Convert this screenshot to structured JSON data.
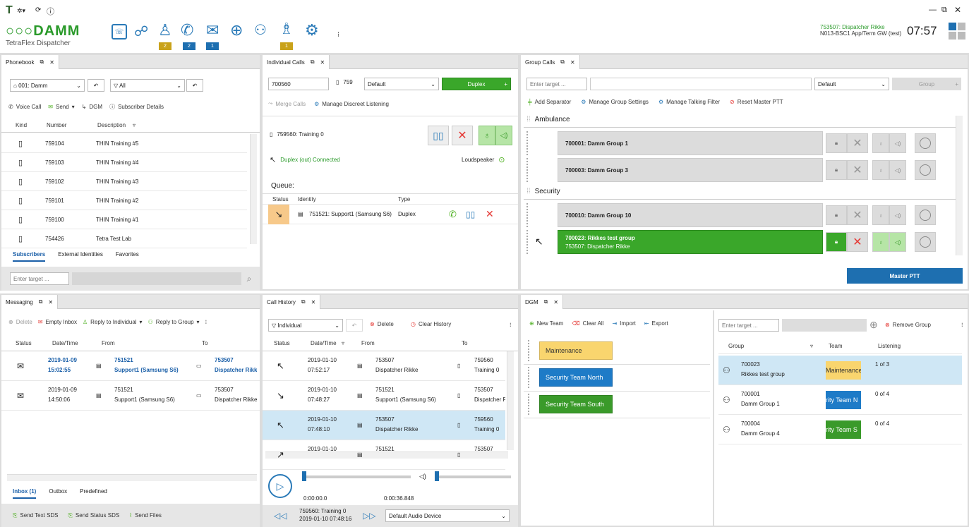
{
  "titlebar": {
    "controls": [
      "—",
      "⧉",
      "✕"
    ]
  },
  "brand": {
    "name": "DAMM",
    "product": "TetraFlex Dispatcher"
  },
  "badges": [
    {
      "count": "2",
      "color": "#c9a21a"
    },
    {
      "count": "2",
      "color": "#1e6fb0"
    },
    {
      "count": "1",
      "color": "#1e6fb0"
    },
    {
      "count": "1",
      "color": "#c9a21a"
    }
  ],
  "status": {
    "user": "753507: Dispatcher Rikke",
    "node": "N013-BSC1 App/Term GW (test)",
    "time": "07:57"
  },
  "phonebook": {
    "tab": "Phonebook",
    "org": "001: Damm",
    "filter": "All",
    "actions": {
      "voice": "Voice Call",
      "send": "Send",
      "dgm": "DGM",
      "details": "Subscriber Details"
    },
    "columns": [
      "Kind",
      "Number",
      "Description"
    ],
    "rows": [
      {
        "number": "759104",
        "desc": "THIN Training #5"
      },
      {
        "number": "759103",
        "desc": "THIN Training #4"
      },
      {
        "number": "759102",
        "desc": "THIN Training #3"
      },
      {
        "number": "759101",
        "desc": "THIN Training #2"
      },
      {
        "number": "759100",
        "desc": "THIN Training #1"
      },
      {
        "number": "754426",
        "desc": "Tetra Test Lab"
      }
    ],
    "subtabs": [
      "Subscribers",
      "External Identities",
      "Favorites"
    ],
    "target_placeholder": "Enter target ..."
  },
  "individual": {
    "tab": "Individual Calls",
    "target": "700560",
    "count": "759",
    "profile": "Default",
    "mode": "Duplex",
    "merge": "Merge Calls",
    "discreet": "Manage Discreet Listening",
    "call_name": "759560: Training 0",
    "call_status": "Duplex (out) Connected",
    "loudspeaker": "Loudspeaker",
    "queue_label": "Queue:",
    "queue_cols": [
      "Status",
      "Identity",
      "Type"
    ],
    "queue_row": {
      "identity": "751521: Support1 (Samsung S6)",
      "type": "Duplex"
    }
  },
  "group": {
    "tab": "Group Calls",
    "target_placeholder": "Enter target ...",
    "profile": "Default",
    "group_btn": "Group",
    "actions": {
      "sep": "Add Separator",
      "settings": "Manage Group Settings",
      "filter": "Manage Talking Filter",
      "reset": "Reset Master PTT"
    },
    "sections": [
      {
        "name": "Ambulance",
        "rows": [
          {
            "title": "700001:  Damm Group 1"
          },
          {
            "title": "700003:  Damm Group 3"
          }
        ]
      },
      {
        "name": "Security",
        "rows": [
          {
            "title": "700010:  Damm Group 10"
          },
          {
            "title": "700023:  Rikkes test group",
            "sub": "753507:  Dispatcher Rikke"
          }
        ]
      }
    ],
    "master": "Master PTT"
  },
  "messaging": {
    "tab": "Messaging",
    "actions": {
      "delete": "Delete",
      "empty": "Empty Inbox",
      "reply_ind": "Reply to Individual",
      "reply_grp": "Reply to Group"
    },
    "columns": [
      "Status",
      "Date/Time",
      "From",
      "To"
    ],
    "rows": [
      {
        "date": "2019-01-09",
        "time": "15:02:55",
        "from_id": "751521",
        "from": "Support1 (Samsung S6)",
        "to_id": "753507",
        "to": "Dispatcher Rikke"
      },
      {
        "date": "2019-01-09",
        "time": "14:50:06",
        "from_id": "751521",
        "from": "Support1 (Samsung S6)",
        "to_id": "753507",
        "to": "Dispatcher Rikke"
      }
    ],
    "subtabs": [
      "Inbox (1)",
      "Outbox",
      "Predefined"
    ],
    "footer": {
      "text": "Send Text SDS",
      "status": "Send Status SDS",
      "files": "Send Files"
    }
  },
  "history": {
    "tab": "Call History",
    "filter": "Individual",
    "delete": "Delete",
    "clear": "Clear History",
    "columns": [
      "Status",
      "Date/Time",
      "From",
      "To"
    ],
    "rows": [
      {
        "date": "2019-01-10",
        "time": "07:52:17",
        "from_id": "753507",
        "from": "Dispatcher Rikke",
        "to_id": "759560",
        "to": "Training 0"
      },
      {
        "date": "2019-01-10",
        "time": "07:48:27",
        "from_id": "751521",
        "from": "Support1 (Samsung S6)",
        "to_id": "753507",
        "to": "Dispatcher Ri"
      },
      {
        "date": "2019-01-10",
        "time": "07:48:10",
        "from_id": "753507",
        "from": "Dispatcher Rikke",
        "to_id": "759560",
        "to": "Training 0"
      },
      {
        "date": "2019-01-10",
        "time": "",
        "from_id": "751521",
        "from": "",
        "to_id": "753507",
        "to": ""
      }
    ],
    "player": {
      "pos": "0:00:00.0",
      "dur": "0:00:36.848",
      "progress": 0.0
    },
    "footer": {
      "name": "759560: Training 0",
      "datetime": "2019-01-10 07:48:16",
      "device": "Default Audio Device"
    }
  },
  "dgm": {
    "tab": "DGM",
    "actions": {
      "new": "New Team",
      "clear": "Clear All",
      "import": "Import",
      "export": "Export"
    },
    "teams": [
      {
        "name": "Maintenance",
        "color": "#f9d56e",
        "text": "#333"
      },
      {
        "name": "Security Team North",
        "color": "#1e7bc7",
        "text": "#fff"
      },
      {
        "name": "Security Team South",
        "color": "#3a9a2a",
        "text": "#fff"
      }
    ],
    "target_placeholder": "Enter target ...",
    "remove": "Remove Group",
    "columns": [
      "Group",
      "Team",
      "Listening"
    ],
    "rows": [
      {
        "id": "700023",
        "name": "Rikkes test group",
        "team": "Maintenance",
        "listen": "1 of 3"
      },
      {
        "id": "700001",
        "name": "Damm Group 1",
        "team": "rity Team N",
        "listen": "0 of 4"
      },
      {
        "id": "700004",
        "name": "Damm Group 4",
        "team": "rity Team S",
        "listen": "0 of 4"
      }
    ]
  }
}
